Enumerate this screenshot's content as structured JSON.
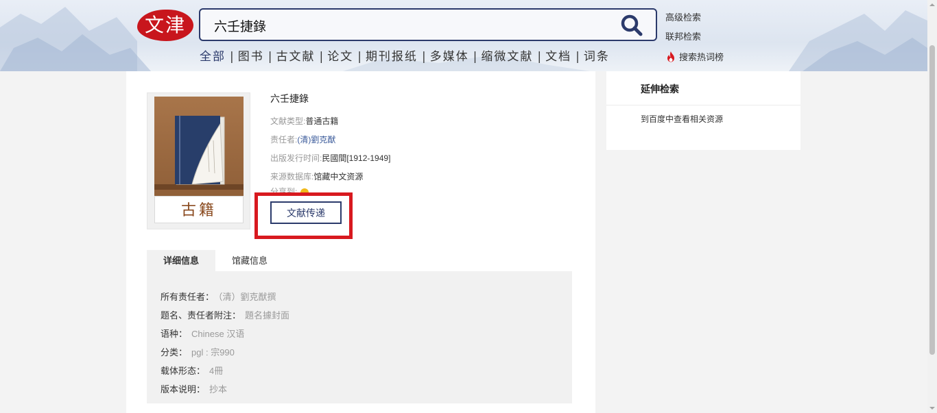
{
  "header": {
    "logo_text": "文津",
    "search": {
      "value": "六壬捷錄",
      "placeholder": ""
    },
    "links": {
      "advanced": "高级检索",
      "union": "联邦检索",
      "hot": "搜索热词榜"
    },
    "categories": [
      "全部",
      "图书",
      "古文献",
      "论文",
      "期刊报纸",
      "多媒体",
      "缩微文献",
      "文档",
      "词条"
    ],
    "separator": "|",
    "accent_color": "#2b3a6b"
  },
  "record": {
    "cover_text": "古籍",
    "title": "六壬捷錄",
    "fields": [
      {
        "label": "文献类型:",
        "value": "普通古籍",
        "link": false
      },
      {
        "label": "责任者:",
        "value": "(清)劉克猷",
        "link": true
      },
      {
        "label": "出版发行时间:",
        "value": "民國間[1912-1949]",
        "link": false
      },
      {
        "label": "来源数据库:",
        "value": "馆藏中文资源",
        "link": false
      }
    ],
    "share_label": "分享到:",
    "deliver_button": "文献传递",
    "highlight_color": "#d8191f"
  },
  "tabs": [
    {
      "label": "详细信息",
      "active": true
    },
    {
      "label": "馆藏信息",
      "active": false
    }
  ],
  "details": [
    {
      "label": "所有责任者：",
      "value": "（清）劉克猷撰"
    },
    {
      "label": "题名、责任者附注：",
      "value": "題名據封面"
    },
    {
      "label": "语种：",
      "value": "Chinese 汉语"
    },
    {
      "label": "分类：",
      "value": "pgl : 宗990"
    },
    {
      "label": "载体形态：",
      "value": "4冊"
    },
    {
      "label": "版本说明：",
      "value": "抄本"
    }
  ],
  "side": {
    "title": "延伸检索",
    "link": "到百度中查看相关资源"
  }
}
